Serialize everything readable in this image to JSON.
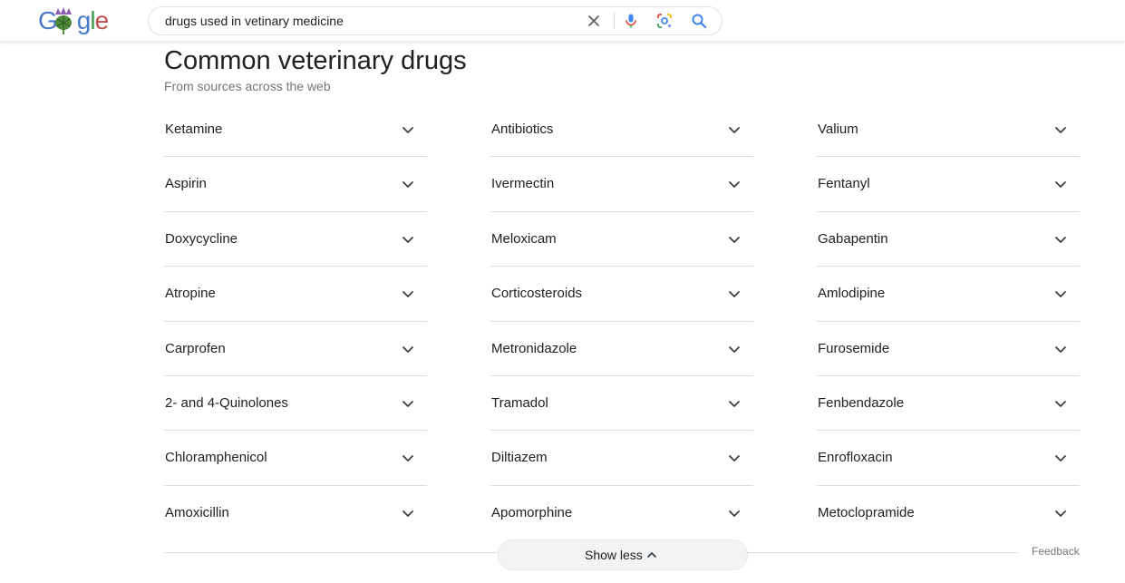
{
  "logo": {
    "text": "Google"
  },
  "search": {
    "query": "drugs used in vetinary medicine"
  },
  "section": {
    "title": "Common veterinary drugs",
    "subtitle": "From sources across the web"
  },
  "columns": [
    {
      "items": [
        "Ketamine",
        "Aspirin",
        "Doxycycline",
        "Atropine",
        "Carprofen",
        "2- and 4-Quinolones",
        "Chloramphenicol",
        "Amoxicillin"
      ]
    },
    {
      "items": [
        "Antibiotics",
        "Ivermectin",
        "Meloxicam",
        "Corticosteroids",
        "Metronidazole",
        "Tramadol",
        "Diltiazem",
        "Apomorphine"
      ]
    },
    {
      "items": [
        "Valium",
        "Fentanyl",
        "Gabapentin",
        "Amlodipine",
        "Furosemide",
        "Fenbendazole",
        "Enrofloxacin",
        "Metoclopramide"
      ]
    }
  ],
  "footer": {
    "show_less": "Show less",
    "feedback": "Feedback"
  },
  "icons": {
    "clear": "close-icon",
    "mic": "microphone-icon",
    "lens": "lens-icon",
    "search": "search-icon",
    "expand": "chevron-down-icon",
    "collapse": "chevron-up-icon"
  },
  "colors": {
    "accent_blue": "#4285f4",
    "text": "#202124",
    "muted": "#70757a",
    "divider": "#dadce0"
  }
}
